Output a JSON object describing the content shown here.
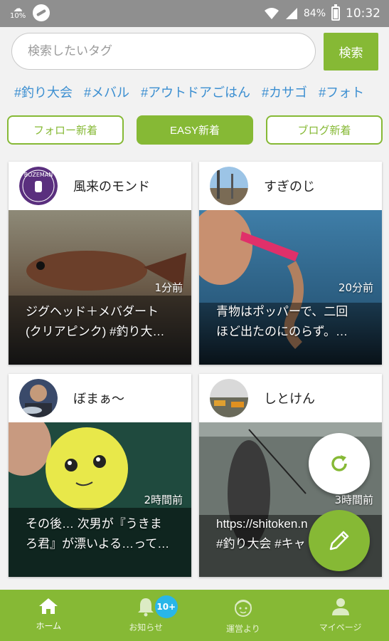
{
  "status_bar": {
    "temperature": "10%",
    "battery_percent": "84%",
    "time": "10:32"
  },
  "search": {
    "placeholder": "検索したいタグ",
    "button_label": "検索"
  },
  "tags": [
    "#釣り大会",
    "#メバル",
    "#アウトドアごはん",
    "#カサゴ",
    "#フォト"
  ],
  "tabs": [
    {
      "label": "フォロー新着",
      "active": false
    },
    {
      "label": "EASY新着",
      "active": true
    },
    {
      "label": "ブログ新着",
      "active": false
    }
  ],
  "cards": [
    {
      "username": "風来のモンド",
      "time": "1分前",
      "text_line1": "ジグヘッド＋メバダート",
      "text_line2": "(クリアピンク) #釣り大…",
      "avatar_text": "BOZEMAN"
    },
    {
      "username": "すぎのじ",
      "time": "20分前",
      "text_line1": "青物はポッパーで、二回",
      "text_line2": "ほど出たのにのらず。…"
    },
    {
      "username": "ぼまぁ〜",
      "time": "2時間前",
      "text_line1": "その後… 次男が『うきま",
      "text_line2": "ろ君』が漂いよる…って…"
    },
    {
      "username": "しとけん",
      "time": "3時間前",
      "text_line1": "https://shitoken.n",
      "text_line2": "#釣り大会 #キャ"
    }
  ],
  "bottom_nav": [
    {
      "label": "ホーム",
      "icon": "home-icon",
      "active": true
    },
    {
      "label": "お知らせ",
      "icon": "bell-icon",
      "badge": "10+"
    },
    {
      "label": "運営より",
      "icon": "face-icon"
    },
    {
      "label": "マイページ",
      "icon": "person-icon"
    }
  ],
  "colors": {
    "accent": "#86b935",
    "tag_link": "#3c8fd1",
    "badge": "#29b6e8",
    "status_bar": "#8f8f8f"
  }
}
